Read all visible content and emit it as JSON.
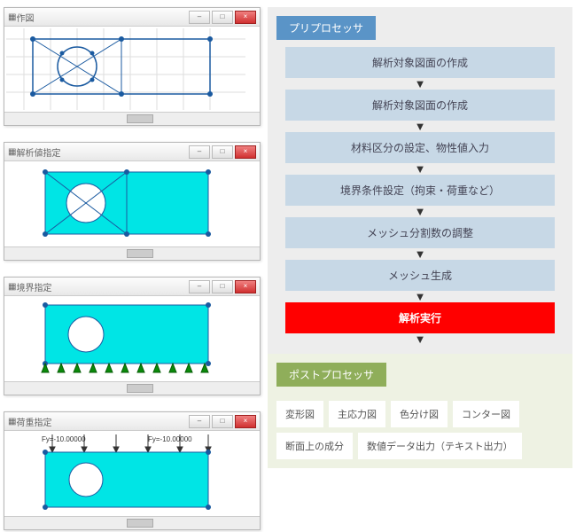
{
  "windows": {
    "w1": {
      "title": "作図"
    },
    "w2": {
      "title": "解析値指定"
    },
    "w3": {
      "title": "境界指定"
    },
    "w4": {
      "title": "荷重指定",
      "loadL": "Fy=-10.00000",
      "loadR": "Fy=-10.00000"
    }
  },
  "flow": {
    "preTag": "プリプロセッサ",
    "steps": [
      "解析対象図面の作成",
      "解析対象図面の作成",
      "材料区分の設定、物性値入力",
      "境界条件設定（拘束・荷重など）",
      "メッシュ分割数の調整",
      "メッシュ生成"
    ],
    "run": "解析実行",
    "postTag": "ポストプロセッサ",
    "post": [
      "変形図",
      "主応力図",
      "色分け図",
      "コンター図",
      "断面上の成分",
      "数値データ出力（テキスト出力）"
    ]
  },
  "colors": {
    "preTag": "#5a94c7",
    "postTag": "#8fae5a"
  }
}
